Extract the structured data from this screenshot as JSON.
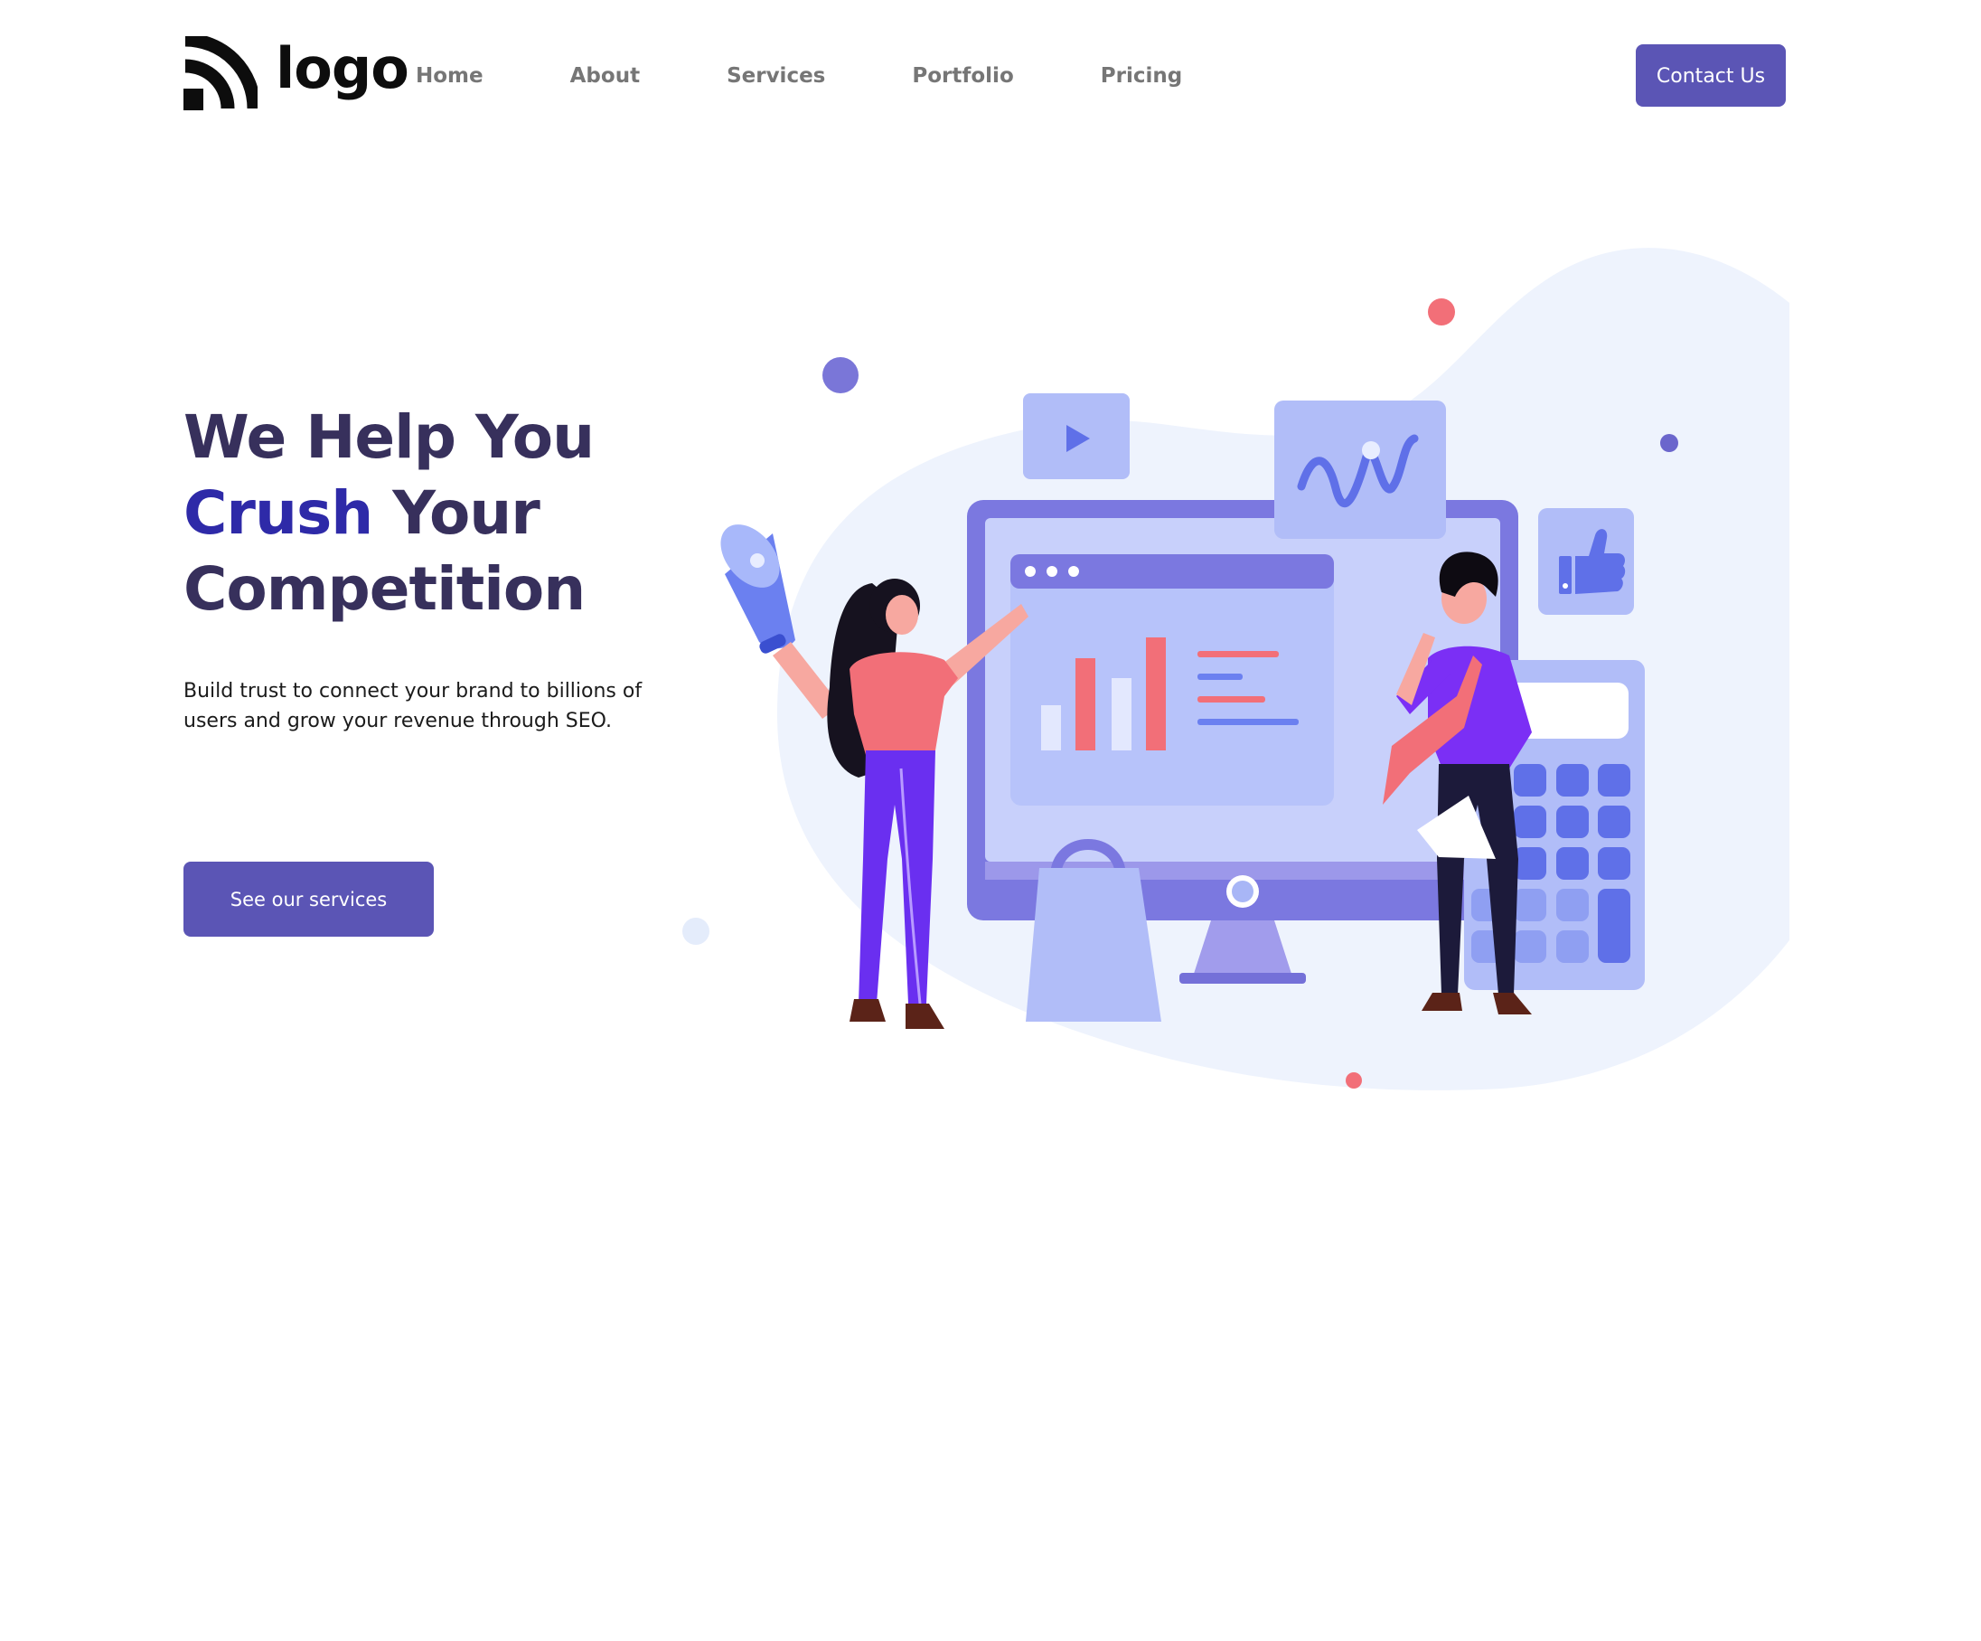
{
  "header": {
    "logo_text": "logo",
    "nav": [
      {
        "label": "Home"
      },
      {
        "label": "About"
      },
      {
        "label": "Services"
      },
      {
        "label": "Portfolio"
      },
      {
        "label": "Pricing"
      }
    ],
    "contact_label": "Contact Us"
  },
  "hero": {
    "heading_line1": "We Help You",
    "heading_accent": "Crush",
    "heading_line2_rest": "Your",
    "heading_line3": "Competition",
    "subtext": "Build trust to connect your brand to billions of users and grow your revenue through SEO.",
    "cta_label": "See our services"
  },
  "theme": {
    "accent": "#5b55b5",
    "heading_color": "#37305c",
    "highlight_color": "#2e2aa8",
    "nav_color": "#767676",
    "blob_color": "#eef3fd"
  }
}
